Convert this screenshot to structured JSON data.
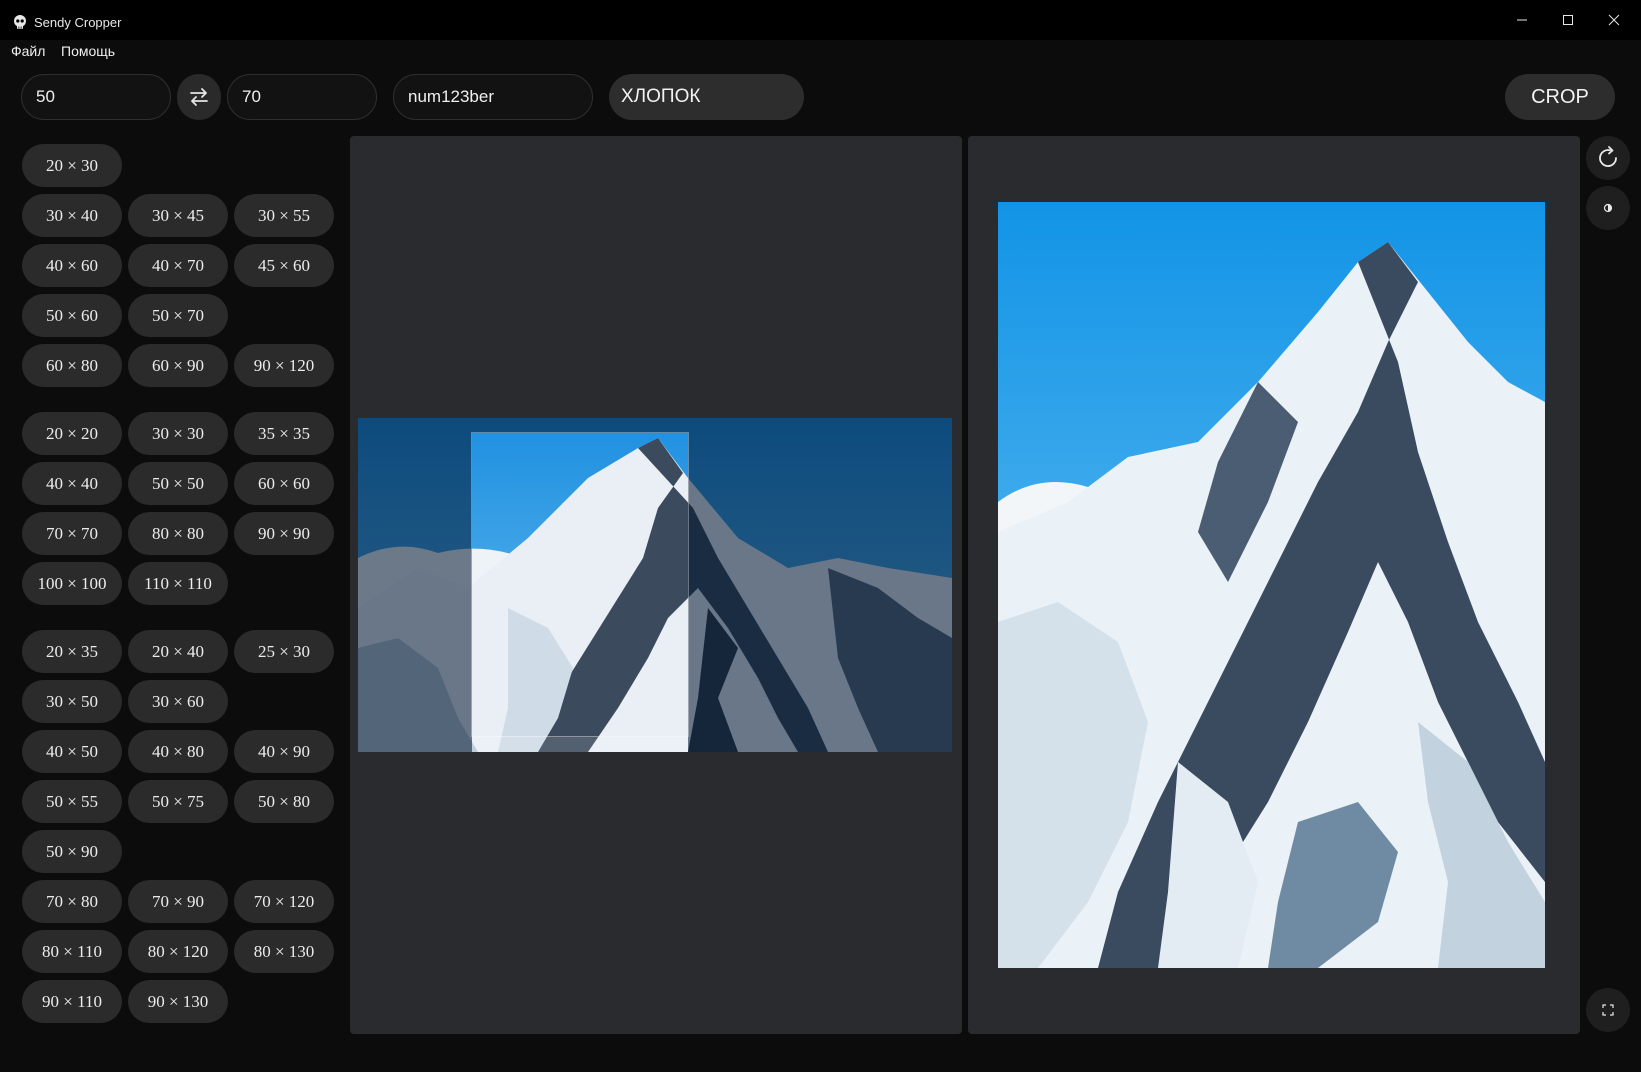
{
  "window": {
    "title": "Sendy Cropper"
  },
  "menu": {
    "file": "Файл",
    "help": "Помощь"
  },
  "toolbar": {
    "width_value": "50",
    "height_value": "70",
    "order_number_value": "num123ber",
    "material": "ХЛОПОК",
    "crop_label": "CROP"
  },
  "sizes": {
    "group1": [
      [
        "20 × 30"
      ],
      [
        "30 × 40",
        "30 × 45",
        "30 × 55"
      ],
      [
        "40 × 60",
        "40 × 70",
        "45 × 60"
      ],
      [
        "50 × 60",
        "50 × 70"
      ],
      [
        "60 × 80",
        "60 × 90",
        "90 × 120"
      ]
    ],
    "group2": [
      [
        "20 × 20",
        "30 × 30",
        "35 × 35"
      ],
      [
        "40 × 40",
        "50 × 50",
        "60 × 60"
      ],
      [
        "70 × 70",
        "80 × 80",
        "90 × 90"
      ],
      [
        "100 × 100",
        "110 × 110"
      ]
    ],
    "group3": [
      [
        "20 × 35",
        "20 × 40",
        "25 × 30"
      ],
      [
        "30 × 50",
        "30 × 60"
      ],
      [
        "40 × 50",
        "40 × 80",
        "40 × 90"
      ],
      [
        "50 × 55",
        "50 × 75",
        "50 × 80"
      ],
      [
        "50 × 90"
      ],
      [
        "70 × 80",
        "70 × 90",
        "70 × 120"
      ],
      [
        "80 × 110",
        "80 × 120",
        "80 × 130"
      ],
      [
        "90 × 110",
        "90 × 130"
      ]
    ]
  },
  "icons": {
    "app": "skull-icon",
    "swap": "swap-arrows-icon",
    "rotate": "rotate-icon",
    "contrast": "contrast-icon",
    "fullscreen": "fullscreen-icon",
    "minimize": "minimize-icon",
    "maximize": "maximize-icon",
    "close": "close-icon"
  }
}
